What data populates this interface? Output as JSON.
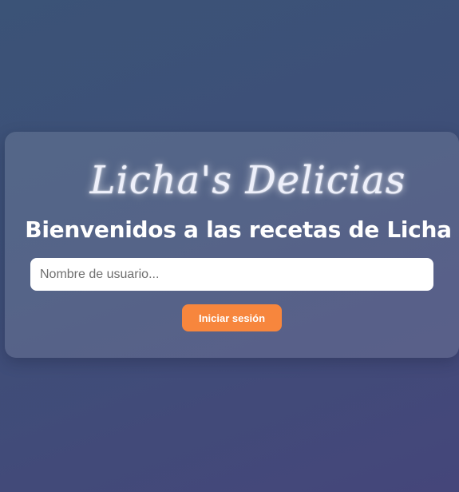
{
  "login": {
    "brand_title": "Licha's Delicias",
    "headline": "Bienvenidos a las recetas de Licha",
    "username_placeholder": "Nombre de usuario...",
    "username_value": "",
    "submit_label": "Iniciar sesión"
  },
  "colors": {
    "background_start": "#3b5377",
    "background_end": "#45467a",
    "button_accent": "#f7863d",
    "text": "#ffffff"
  }
}
